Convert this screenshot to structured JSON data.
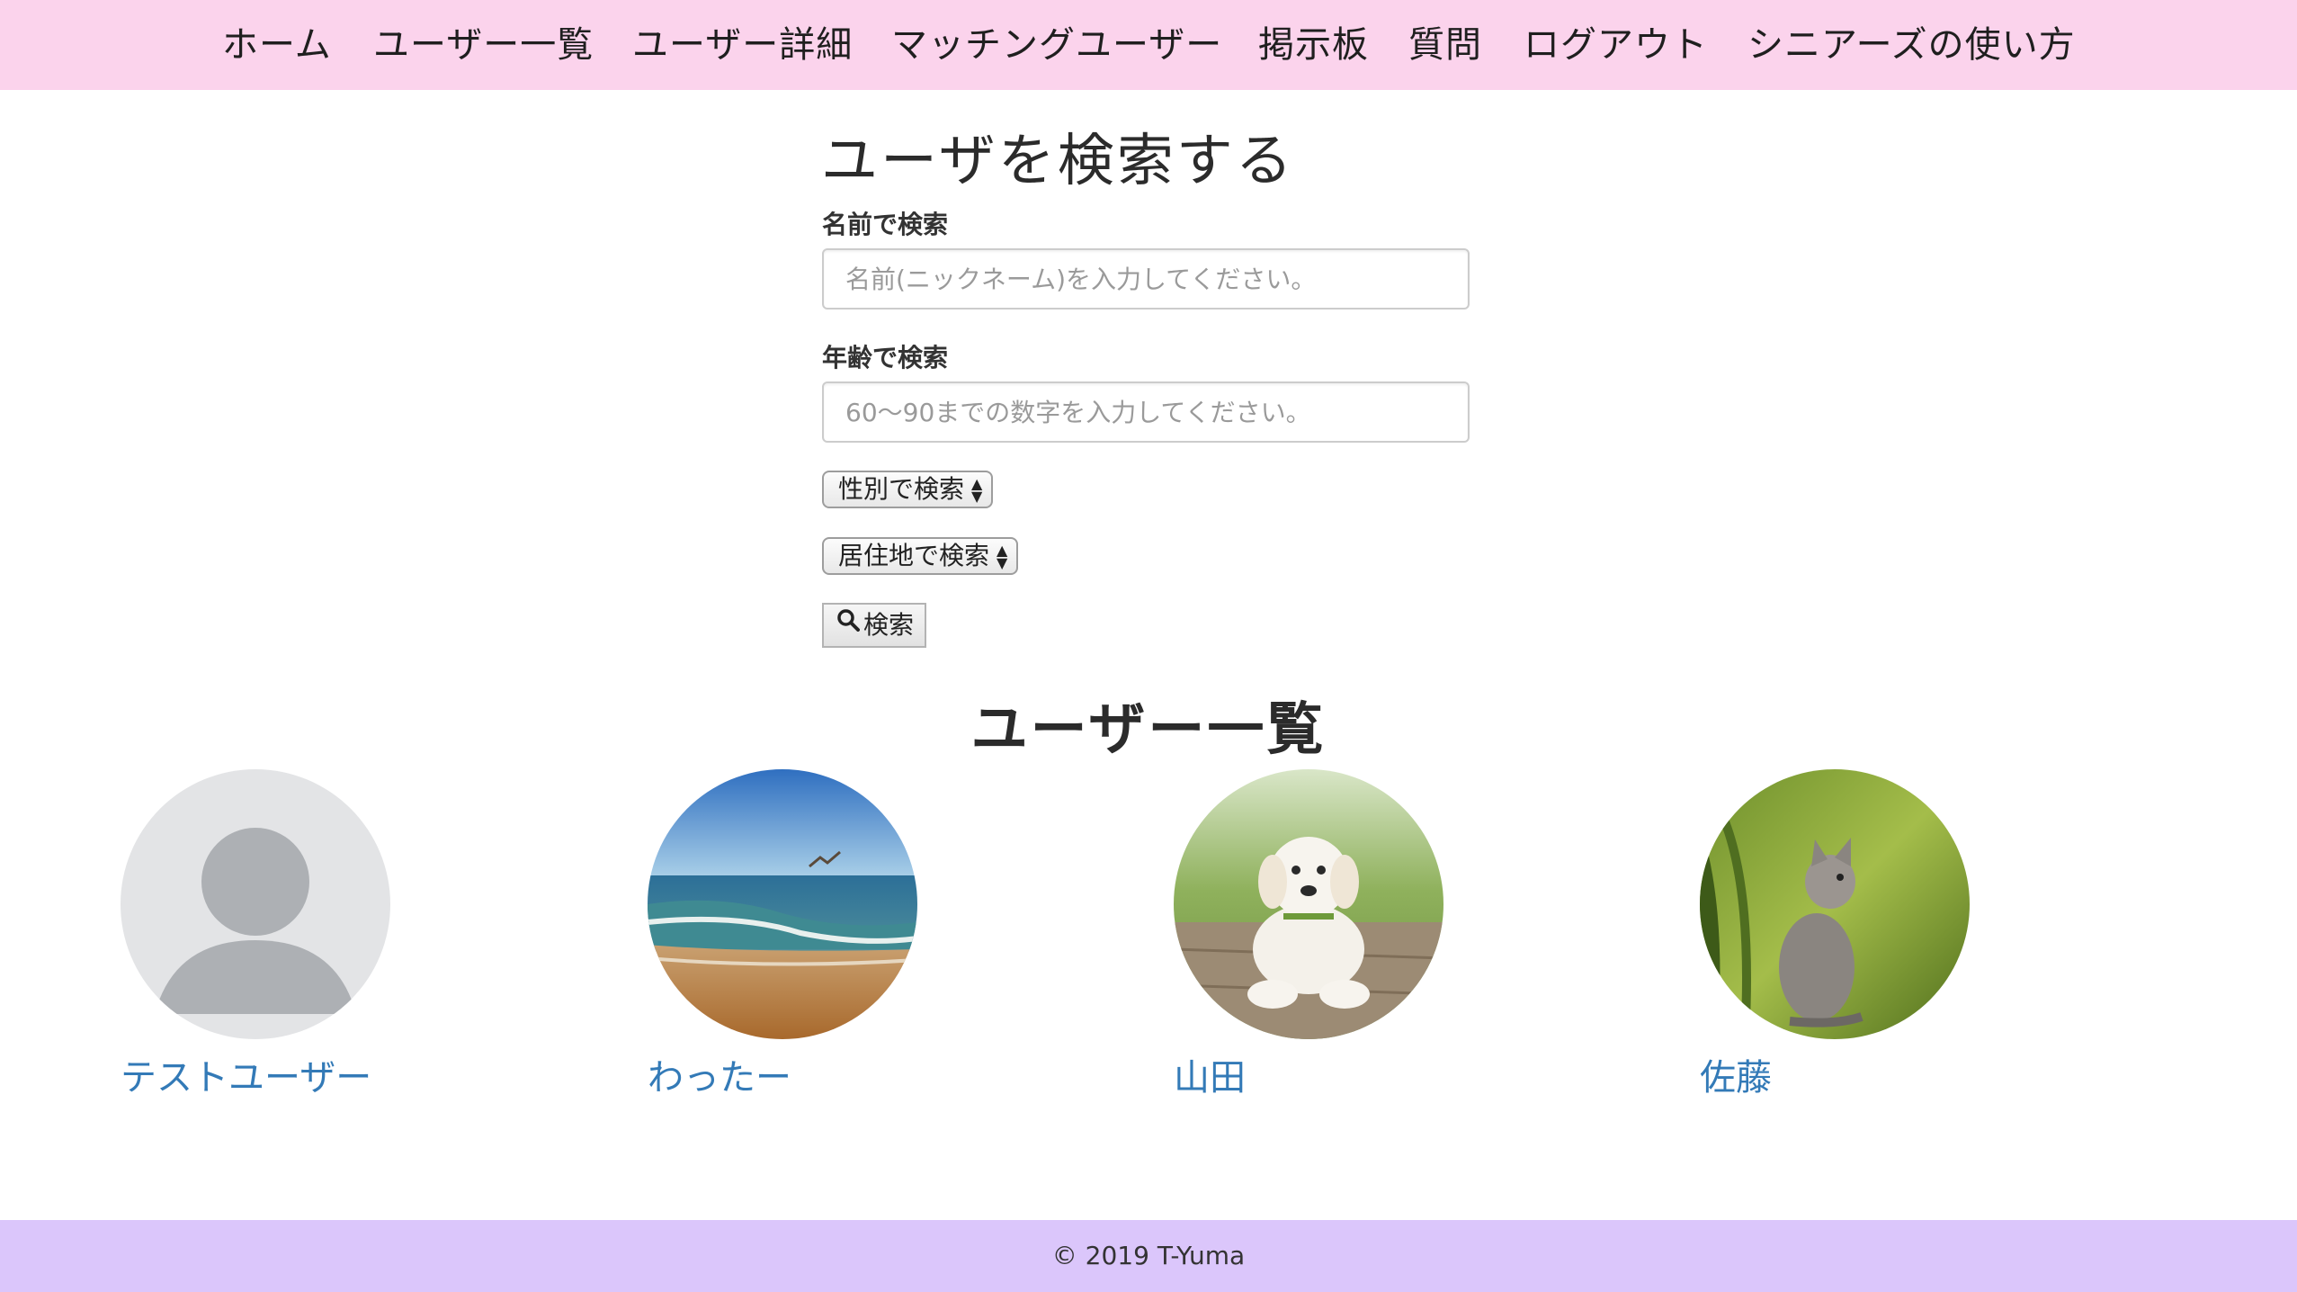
{
  "nav": {
    "home": "ホーム",
    "user_list": "ユーザー一覧",
    "user_detail": "ユーザー詳細",
    "matching_users": "マッチングユーザー",
    "board": "掲示板",
    "questions": "質問",
    "logout": "ログアウト",
    "how_to_use": "シニアーズの使い方"
  },
  "search": {
    "title": "ユーザを検索する",
    "name_label": "名前で検索",
    "name_placeholder": "名前(ニックネーム)を入力してください。",
    "age_label": "年齢で検索",
    "age_placeholder": "60〜90までの数字を入力してください。",
    "gender_select": "性別で検索",
    "residence_select": "居住地で検索",
    "submit_label": "検索"
  },
  "user_list": {
    "title": "ユーザー一覧",
    "users": [
      {
        "name": "テストユーザー",
        "avatar": "default-person-icon"
      },
      {
        "name": "わったー",
        "avatar": "beach-photo"
      },
      {
        "name": "山田",
        "avatar": "puppy-photo"
      },
      {
        "name": "佐藤",
        "avatar": "kitten-photo"
      }
    ]
  },
  "footer": {
    "copyright": "© 2019 T-Yuma"
  },
  "colors": {
    "nav_bg": "#fbd3ec",
    "footer_bg": "#dbc6fb",
    "link": "#337ab7"
  }
}
